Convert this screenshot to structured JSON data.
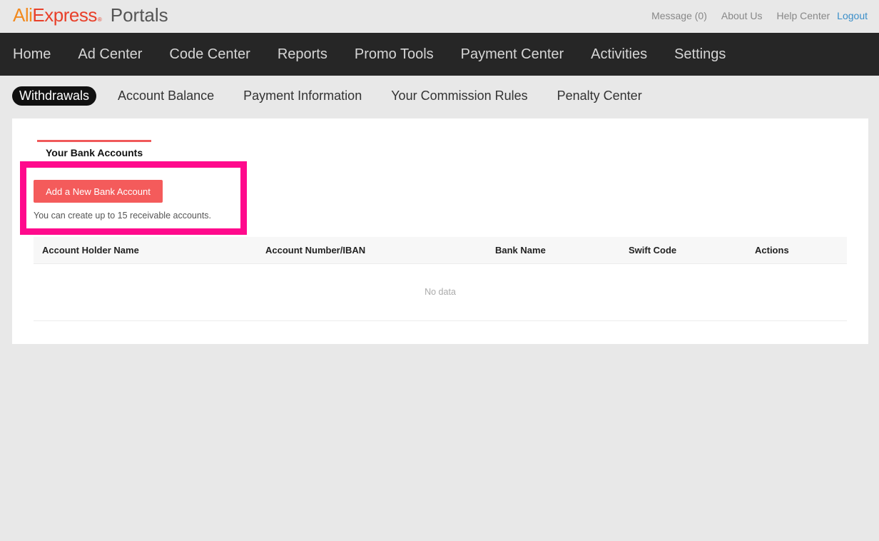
{
  "brand": {
    "ali": "Ali",
    "express": "Express",
    "tm": "®",
    "portals": "Portals"
  },
  "top_links": {
    "message": "Message (0)",
    "about": "About Us",
    "help": "Help Center",
    "logout": "Logout"
  },
  "main_nav": [
    "Home",
    "Ad Center",
    "Code Center",
    "Reports",
    "Promo Tools",
    "Payment Center",
    "Activities",
    "Settings"
  ],
  "sub_nav": {
    "active": "Withdrawals",
    "items": [
      "Account Balance",
      "Payment Information",
      "Your Commission Rules",
      "Penalty Center"
    ]
  },
  "panel": {
    "tab_label": "Your Bank Accounts",
    "add_button": "Add a New Bank Account",
    "hint": "You can create up to 15 receivable accounts.",
    "table": {
      "columns": [
        "Account Holder Name",
        "Account Number/IBAN",
        "Bank Name",
        "Swift Code",
        "Actions"
      ],
      "rows": [],
      "empty_text": "No data"
    }
  },
  "colors": {
    "accent": "#f45b5b",
    "highlight": "#ff0a8c",
    "nav_bg": "#262626",
    "link": "#3a8ec9"
  }
}
